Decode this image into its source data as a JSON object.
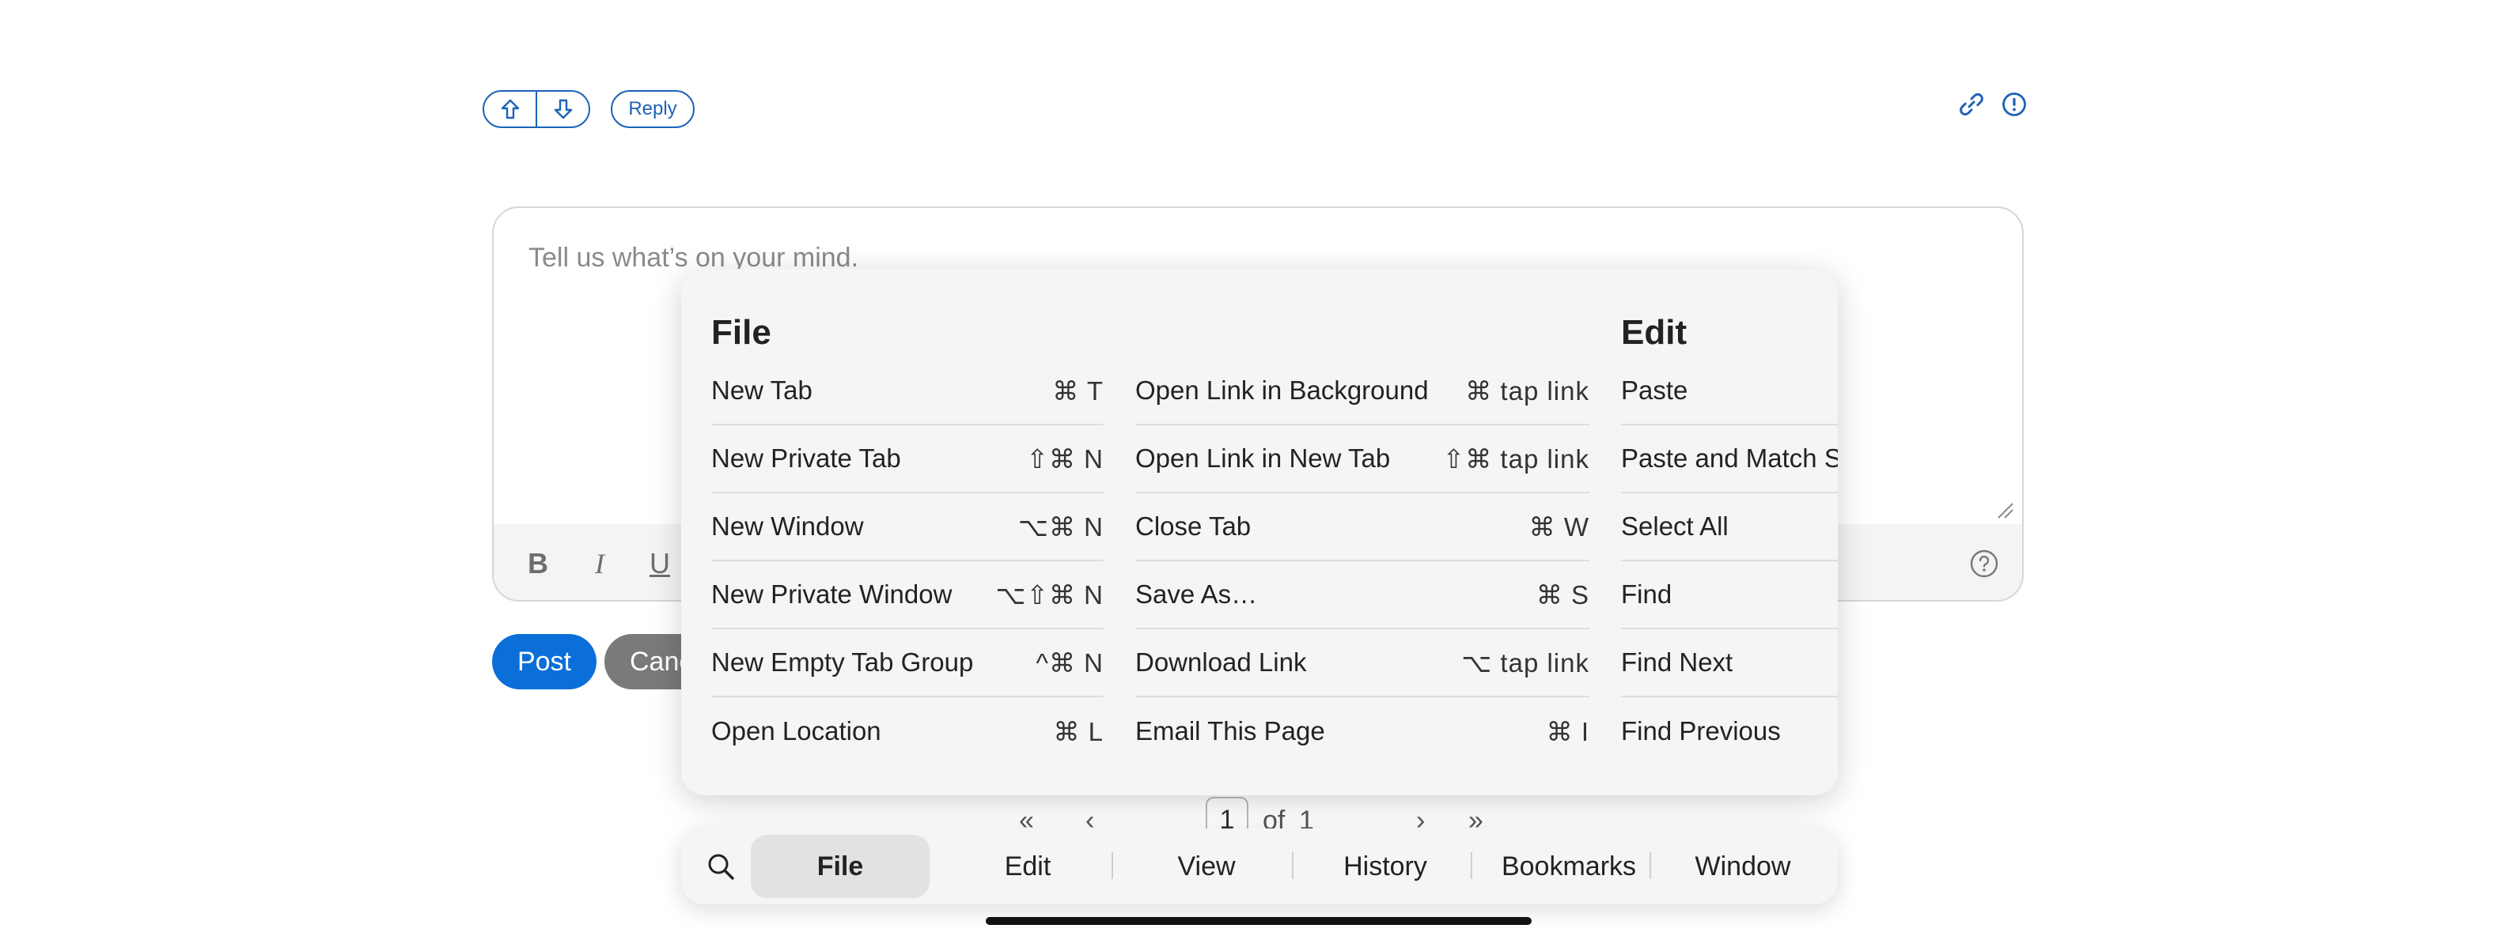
{
  "thread": {
    "reply_label": "Reply",
    "upvote_icon": "arrow-up-icon",
    "downvote_icon": "arrow-down-icon",
    "link_icon": "link-icon",
    "report_icon": "alert-icon"
  },
  "editor": {
    "placeholder": "Tell us what’s on your mind.",
    "bold": "B",
    "italic": "I",
    "underline": "U"
  },
  "actions": {
    "post_label": "Post",
    "cancel_label": "Canc"
  },
  "pagination": {
    "current": "1",
    "of_label": "of",
    "total": "1"
  },
  "shortcuts": {
    "file_title": "File",
    "edit_title": "Edit",
    "file_col1": [
      {
        "label": "New Tab",
        "shortcut": "⌘ T"
      },
      {
        "label": "New Private Tab",
        "shortcut": "⇧⌘ N"
      },
      {
        "label": "New Window",
        "shortcut": "⌥⌘ N"
      },
      {
        "label": "New Private Window",
        "shortcut": "⌥⇧⌘ N"
      },
      {
        "label": "New Empty Tab Group",
        "shortcut": "^⌘ N"
      },
      {
        "label": "Open Location",
        "shortcut": "⌘ L"
      }
    ],
    "file_col2": [
      {
        "label": "Open Link in Background",
        "shortcut": "⌘ tap link"
      },
      {
        "label": "Open Link in New Tab",
        "shortcut": "⇧⌘ tap link"
      },
      {
        "label": "Close Tab",
        "shortcut": "⌘ W"
      },
      {
        "label": "Save As…",
        "shortcut": "⌘ S"
      },
      {
        "label": "Download Link",
        "shortcut": "⌥ tap link"
      },
      {
        "label": "Email This Page",
        "shortcut": "⌘ I"
      }
    ],
    "edit_col": [
      {
        "label": "Paste"
      },
      {
        "label": "Paste and Match St"
      },
      {
        "label": "Select All"
      },
      {
        "label": "Find"
      },
      {
        "label": "Find Next"
      },
      {
        "label": "Find Previous"
      }
    ]
  },
  "tabbar": {
    "search_icon": "search-icon",
    "tabs": [
      "File",
      "Edit",
      "View",
      "History",
      "Bookmarks",
      "Window"
    ],
    "active": "File"
  },
  "colors": {
    "accent": "#1d63b8",
    "post_button": "#0a6fd8",
    "cancel_button": "#7a7a7a"
  }
}
